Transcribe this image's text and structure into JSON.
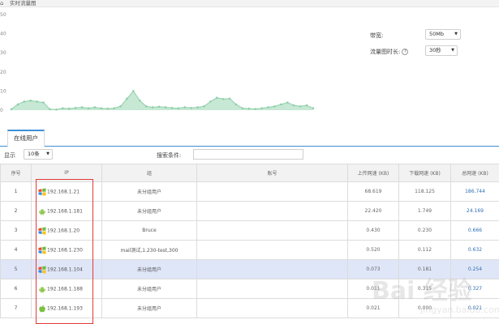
{
  "header": {
    "title": "实时流量图"
  },
  "chart_data": {
    "type": "area",
    "y_ticks": [
      "50",
      "40",
      "30",
      "20",
      "10",
      "0"
    ],
    "ylim": [
      0,
      50
    ],
    "x": [
      0,
      1,
      2,
      3,
      4,
      5,
      6,
      7,
      8,
      9,
      10,
      11,
      12,
      13,
      14,
      15,
      16,
      17,
      18,
      19,
      20,
      21,
      22,
      23,
      24,
      25,
      26,
      27,
      28,
      29,
      30,
      31,
      32,
      33,
      34,
      35,
      36,
      37,
      38,
      39,
      40,
      41,
      42,
      43,
      44,
      45,
      46,
      47
    ],
    "values": [
      0.5,
      3,
      4.5,
      5,
      4.5,
      4,
      0.5,
      0.3,
      1,
      0.8,
      1.2,
      1.5,
      1,
      1.5,
      1,
      0.8,
      1,
      2,
      6,
      10,
      5,
      2,
      1.5,
      1.8,
      1.5,
      1.2,
      1,
      1.5,
      1.2,
      1.5,
      2,
      4.5,
      6.5,
      5.8,
      6,
      3,
      1,
      0.8,
      0.6,
      1,
      1.5,
      2,
      3,
      4,
      2.5,
      2,
      2.5,
      1
    ],
    "grid": false,
    "colors": {
      "fill": "#c6e8d4",
      "line": "#8fcfa9",
      "point": "#8fcfa9"
    }
  },
  "controls": {
    "bandwidth_label": "带宽:",
    "bandwidth_value": "50Mb",
    "duration_label": "流量图时长:",
    "duration_value": "30秒",
    "help_glyph": "?"
  },
  "tab": {
    "label": "在线用户"
  },
  "filter": {
    "show_label": "显示",
    "page_size": "10条",
    "search_label": "搜索条件:",
    "search_value": ""
  },
  "table": {
    "headers": [
      "序号",
      "IP",
      "组",
      "账号",
      "上传网速 (KB)",
      "下载网速 (KB)",
      "总网速 (KB)"
    ],
    "rows": [
      {
        "no": "1",
        "os": "windows",
        "ip": "192.168.1.21",
        "group": "未分组用户",
        "account": "",
        "up": "68.619",
        "down": "118.125",
        "total": "186.744"
      },
      {
        "no": "2",
        "os": "android",
        "ip": "192.168.1.181",
        "group": "未分组用户",
        "account": "",
        "up": "22.420",
        "down": "1.749",
        "total": "24.169"
      },
      {
        "no": "3",
        "os": "windows",
        "ip": "192.168.1.20",
        "group": "Bruce",
        "account": "",
        "up": "0.430",
        "down": "0.230",
        "total": "0.666"
      },
      {
        "no": "4",
        "os": "windows",
        "ip": "192.168.1.230",
        "group": "mail测试,1.230-test,300",
        "account": "",
        "up": "0.520",
        "down": "0.112",
        "total": "0.632"
      },
      {
        "no": "5",
        "os": "windows",
        "ip": "192.168.1.104",
        "group": "未分组用户",
        "account": "",
        "up": "0.073",
        "down": "0.181",
        "total": "0.254"
      },
      {
        "no": "6",
        "os": "android",
        "ip": "192.168.1.188",
        "group": "未分组用户",
        "account": "",
        "up": "0.011",
        "down": "0.315",
        "total": "0.327"
      },
      {
        "no": "7",
        "os": "apple",
        "ip": "192.168.1.193",
        "group": "未分组用户",
        "account": "",
        "up": "0.021",
        "down": "0.000",
        "total": "0.021"
      }
    ]
  },
  "watermark": {
    "text": "Bai 经验",
    "sub": "jingyan.baidu.com"
  }
}
